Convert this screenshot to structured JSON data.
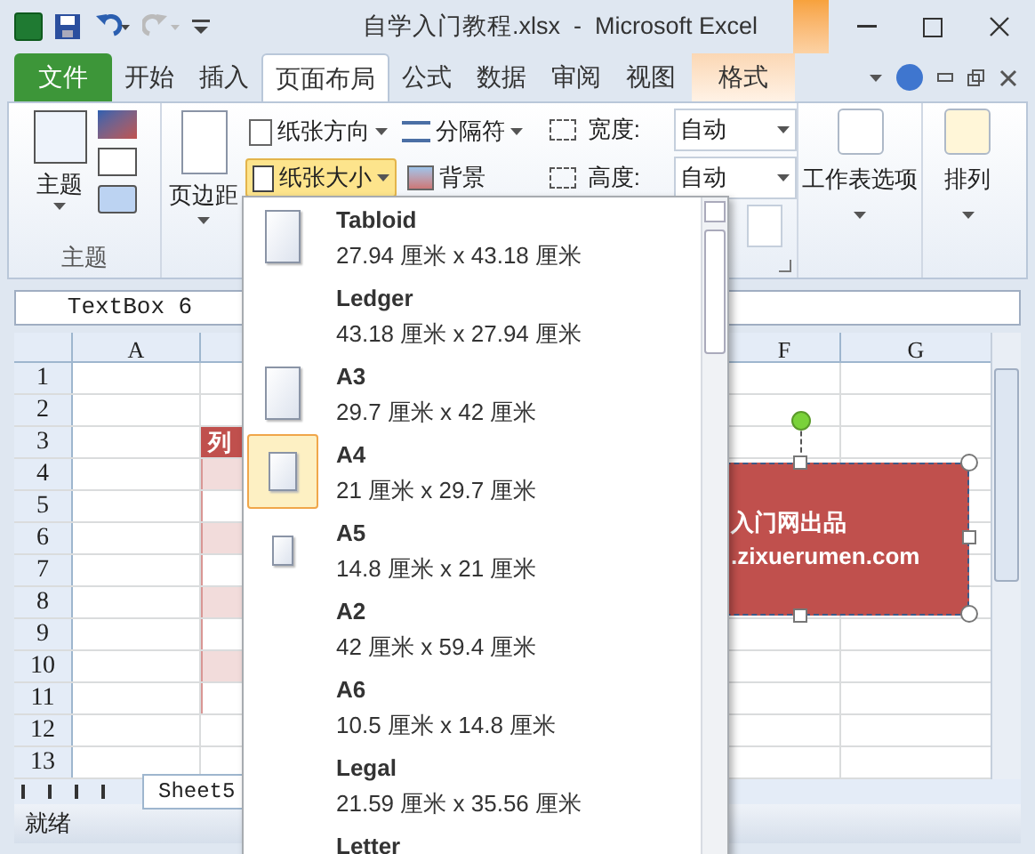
{
  "window": {
    "title": "自学入门教程.xlsx  -  Microsoft Excel"
  },
  "ribbon_tabs": [
    {
      "label": "文件",
      "kind": "file",
      "selected": false
    },
    {
      "label": "开始",
      "kind": "normal",
      "selected": false
    },
    {
      "label": "插入",
      "kind": "normal",
      "selected": false
    },
    {
      "label": "页面布局",
      "kind": "normal",
      "selected": true
    },
    {
      "label": "公式",
      "kind": "normal",
      "selected": false
    },
    {
      "label": "数据",
      "kind": "normal",
      "selected": false
    },
    {
      "label": "审阅",
      "kind": "normal",
      "selected": false
    },
    {
      "label": "视图",
      "kind": "normal",
      "selected": false
    },
    {
      "label": "格式",
      "kind": "contextual",
      "selected": false
    }
  ],
  "themes_group": {
    "themes_button": "主题",
    "group_label": "主题"
  },
  "page_setup": {
    "margins": "页边距",
    "orientation": "纸张方向",
    "breaks": "分隔符",
    "size": {
      "label": "纸张大小",
      "selected": true
    },
    "background": "背景"
  },
  "scale_to_fit": {
    "width_label": "宽度:",
    "width_value": "自动",
    "height_label": "高度:",
    "height_value": "自动"
  },
  "sheet_options": "工作表选项",
  "arrange": "排列",
  "name_box": "TextBox 6",
  "columns": [
    "A",
    "F",
    "G"
  ],
  "rows": [
    {
      "label": "1",
      "kind": "empty"
    },
    {
      "label": "2",
      "kind": "empty"
    },
    {
      "label": "3",
      "kind": "header",
      "text": "列"
    },
    {
      "label": "4",
      "kind": "band"
    },
    {
      "label": "5",
      "kind": "plain"
    },
    {
      "label": "6",
      "kind": "band"
    },
    {
      "label": "7",
      "kind": "plain"
    },
    {
      "label": "8",
      "kind": "band"
    },
    {
      "label": "9",
      "kind": "plain"
    },
    {
      "label": "10",
      "kind": "band"
    },
    {
      "label": "11",
      "kind": "plain"
    },
    {
      "label": "12",
      "kind": "empty"
    },
    {
      "label": "13",
      "kind": "empty"
    }
  ],
  "text_box": {
    "lines": [
      "入门网出品",
      ".zixuerumen.com"
    ]
  },
  "sheet_tab": "Sheet5",
  "status": "就绪",
  "paper_sizes": [
    {
      "name": "Tabloid",
      "size": "27.94 厘米 x 43.18 厘米",
      "kind": "large",
      "selected": false
    },
    {
      "name": "Ledger",
      "size": "43.18 厘米 x 27.94 厘米",
      "kind": "plain",
      "selected": false
    },
    {
      "name": "A3",
      "size": "29.7 厘米 x 42 厘米",
      "kind": "large",
      "selected": false
    },
    {
      "name": "A4",
      "size": "21 厘米 x 29.7 厘米",
      "kind": "medium",
      "selected": true
    },
    {
      "name": "A5",
      "size": "14.8 厘米 x 21 厘米",
      "kind": "small",
      "selected": false
    },
    {
      "name": "A2",
      "size": "42 厘米 x 59.4 厘米",
      "kind": "plain",
      "selected": false
    },
    {
      "name": "A6",
      "size": "10.5 厘米 x 14.8 厘米",
      "kind": "plain",
      "selected": false
    },
    {
      "name": "Legal",
      "size": "21.59 厘米 x 35.56 厘米",
      "kind": "plain",
      "selected": false
    },
    {
      "name": "Letter",
      "kind": "plain",
      "selected": false
    }
  ]
}
